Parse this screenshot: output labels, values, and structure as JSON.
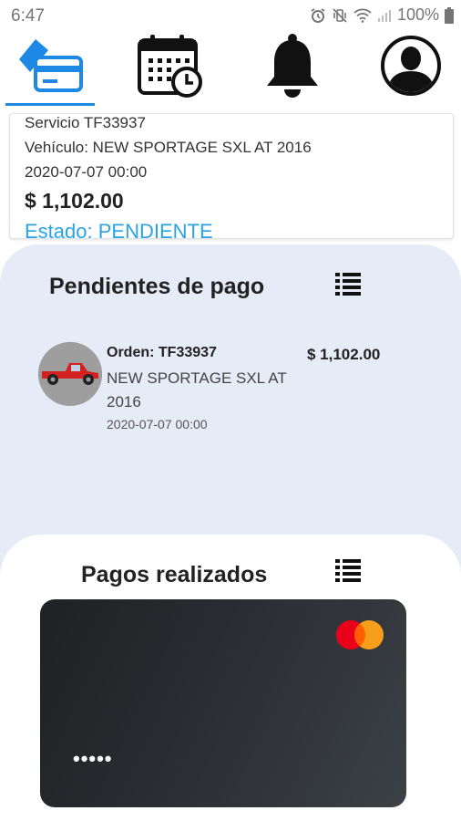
{
  "status_bar": {
    "time": "6:47",
    "battery_percent": "100%"
  },
  "nav": {
    "tabs": [
      {
        "icon": "payment-card-icon",
        "active": true
      },
      {
        "icon": "calendar-clock-icon",
        "active": false
      },
      {
        "icon": "bell-icon",
        "active": false
      },
      {
        "icon": "profile-icon",
        "active": false
      }
    ],
    "accent_color": "#1e88e5"
  },
  "service_card": {
    "service": "Servicio TF33937",
    "vehicle": "Vehículo: NEW SPORTAGE SXL AT 2016",
    "date": "2020-07-07 00:00",
    "amount": "$ 1,102.00",
    "status": "Estado: PENDIENTE",
    "status_color": "#29a3e6"
  },
  "pending": {
    "title": "Pendientes de pago",
    "background_color": "#e6ebf8",
    "items": [
      {
        "order": "Orden: TF33937",
        "vehicle": "NEW SPORTAGE SXL AT 2016",
        "date": "2020-07-07 00:00",
        "amount": "$ 1,102.00",
        "avatar_icon": "red-pickup-truck-icon"
      }
    ]
  },
  "payments": {
    "title": "Pagos realizados",
    "card": {
      "masked_number": "•••••",
      "brand_icon": "mastercard-logo-icon"
    }
  }
}
